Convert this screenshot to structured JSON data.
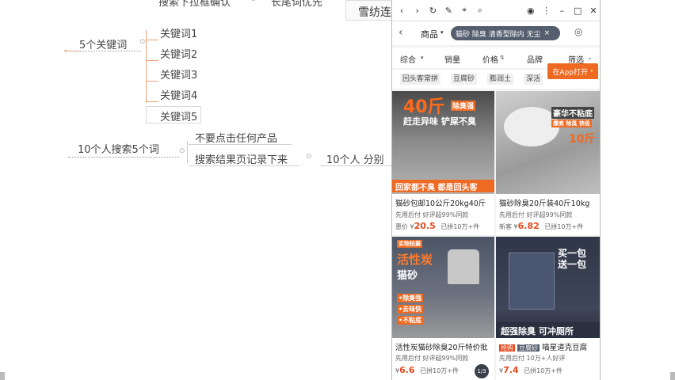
{
  "mindmap": {
    "top_items": [
      "搜索下拉框确认",
      "长尾词优先"
    ],
    "top_right_label": "雪纺连",
    "root": "5个关键词",
    "keywords": [
      "关键词1",
      "关键词2",
      "关键词3",
      "关键词4",
      "关键词5"
    ],
    "search_root": "10个人搜索5个词",
    "search_children": [
      "不要点击任何产品",
      "搜索结果页记录下来"
    ],
    "split_label": "10个人 分别"
  },
  "app": {
    "search_tab": "商品",
    "search_chip": "猫砂 除臭 清香型除内 无尘",
    "sort_items": [
      "综合",
      "销量",
      "价格",
      "品牌",
      "筛选"
    ],
    "filter_tags": [
      "回头客常拼",
      "豆腐砂",
      "膨润土",
      "深活"
    ],
    "app_button": "在App打开",
    "products": [
      {
        "image_headline": "40斤",
        "image_badge": "除臭强",
        "image_sub": "赶走异味 铲屎不臭",
        "image_banner": "回家都不臭 都是回头客",
        "title": "猫砂包邮10公斤20kg40斤",
        "meta": "先用后付  好评超99%同款",
        "price_prefix": "惠价 ¥",
        "price": "20.5",
        "sales": "已拼10万+件"
      },
      {
        "image_headline": "豪华不粘底",
        "image_badge": "爆卖 除臭 快吸",
        "image_sub": "10斤",
        "title": "猫砂除臭20斤装40斤10kg",
        "meta": "先用后付  好评超99%同款",
        "price_prefix": "新客 ¥",
        "price": "6.82",
        "sales": "已拼10万+件"
      },
      {
        "image_headline": "活性炭",
        "image_badge": "实物拍摄",
        "image_sub": "猫砂",
        "image_points": [
          "•除臭强",
          "•去味快",
          "•不粘底"
        ],
        "title": "活性炭猫砂除臭20斤特价批",
        "meta": "先用后付  好评超99%同款",
        "price_prefix": "¥",
        "price": "6.6",
        "sales": "已拼10万+件"
      },
      {
        "image_headline": "买一包 送一包",
        "image_banner": "超强除臭  可冲厕所",
        "badge_1": "抢购",
        "badge_2": "豆腐砂",
        "title": "喵星道克豆腐",
        "meta": "先用后付  10万+人好评",
        "price_prefix": "¥",
        "price": "7.4",
        "sales": "已拼10万+件"
      }
    ]
  },
  "colors": {
    "accent": "#ee6a22",
    "price": "#e4491c",
    "chip": "#555e6e",
    "branch": "#e8a07a"
  }
}
